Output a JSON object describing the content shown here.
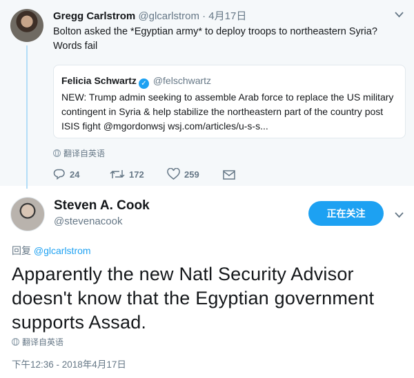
{
  "tweet1": {
    "author_name": "Gregg Carlstrom",
    "author_handle": "@glcarlstrom",
    "separator": " · ",
    "date": "4月17日",
    "text": "Bolton asked the *Egyptian army* to deploy troops to northeastern Syria? Words fail",
    "quote": {
      "author_name": "Felicia Schwartz",
      "author_handle": "@felschwartz",
      "text": "NEW: Trump admin seeking to assemble Arab force to replace the US military contingent in Syria & help stabilize the northeastern part of the country post ISIS fight @mgordonwsj wsj.com/articles/u-s-s..."
    },
    "translate_label": "翻译自英语",
    "actions": {
      "replies": "24",
      "retweets": "172",
      "likes": "259"
    }
  },
  "tweet2": {
    "author_name": "Steven A. Cook",
    "author_handle": "@stevenacook",
    "follow_label": "正在关注",
    "reply_prefix": "回复 ",
    "reply_to": "@glcarlstrom",
    "text": "Apparently the new Natl Security Advisor doesn't know that the Egyptian government supports Assad.",
    "translate_label": "翻译自英语",
    "timestamp": "下午12:36 - 2018年4月17日"
  },
  "icons": [
    "chevron-down-icon",
    "verified-icon",
    "globe-icon",
    "reply-icon",
    "retweet-icon",
    "like-icon",
    "message-icon"
  ],
  "colors": {
    "accent": "#1da1f2",
    "muted": "#657786",
    "thread_line": "#b3ddf7",
    "top_bg": "#f5f8fa"
  }
}
